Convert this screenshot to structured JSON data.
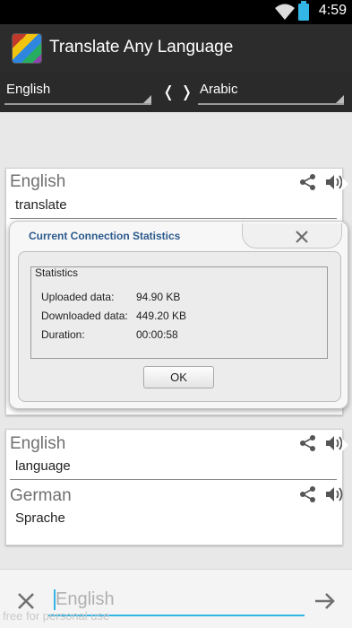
{
  "status_bar": {
    "time": "4:59",
    "icons": [
      "wifi-icon",
      "battery-charging-icon"
    ]
  },
  "action_bar": {
    "title": "Translate Any Language",
    "icon": "flags-app-icon"
  },
  "language_bar": {
    "from_language": "English",
    "swap_symbol": "❬❭",
    "to_language": "Arabic"
  },
  "cards": [
    {
      "language": "English",
      "text": "translate"
    },
    {
      "language": "English",
      "text": "language"
    },
    {
      "language": "German",
      "text": "Sprache"
    }
  ],
  "dialog": {
    "title": "Current Connection Statistics",
    "group_title": "Statistics",
    "stats": [
      {
        "label": "Uploaded data:",
        "value": "94.90 KB"
      },
      {
        "label": "Downloaded data:",
        "value": "449.20 KB"
      },
      {
        "label": "Duration:",
        "value": "00:00:58"
      }
    ],
    "ok_label": "OK"
  },
  "input_bar": {
    "placeholder": "English",
    "value": ""
  },
  "watermark": "free for personal use",
  "colors": {
    "accent": "#33b5e5",
    "dialog_title": "#2b5a8c",
    "action_bar": "#2c2c2c"
  }
}
